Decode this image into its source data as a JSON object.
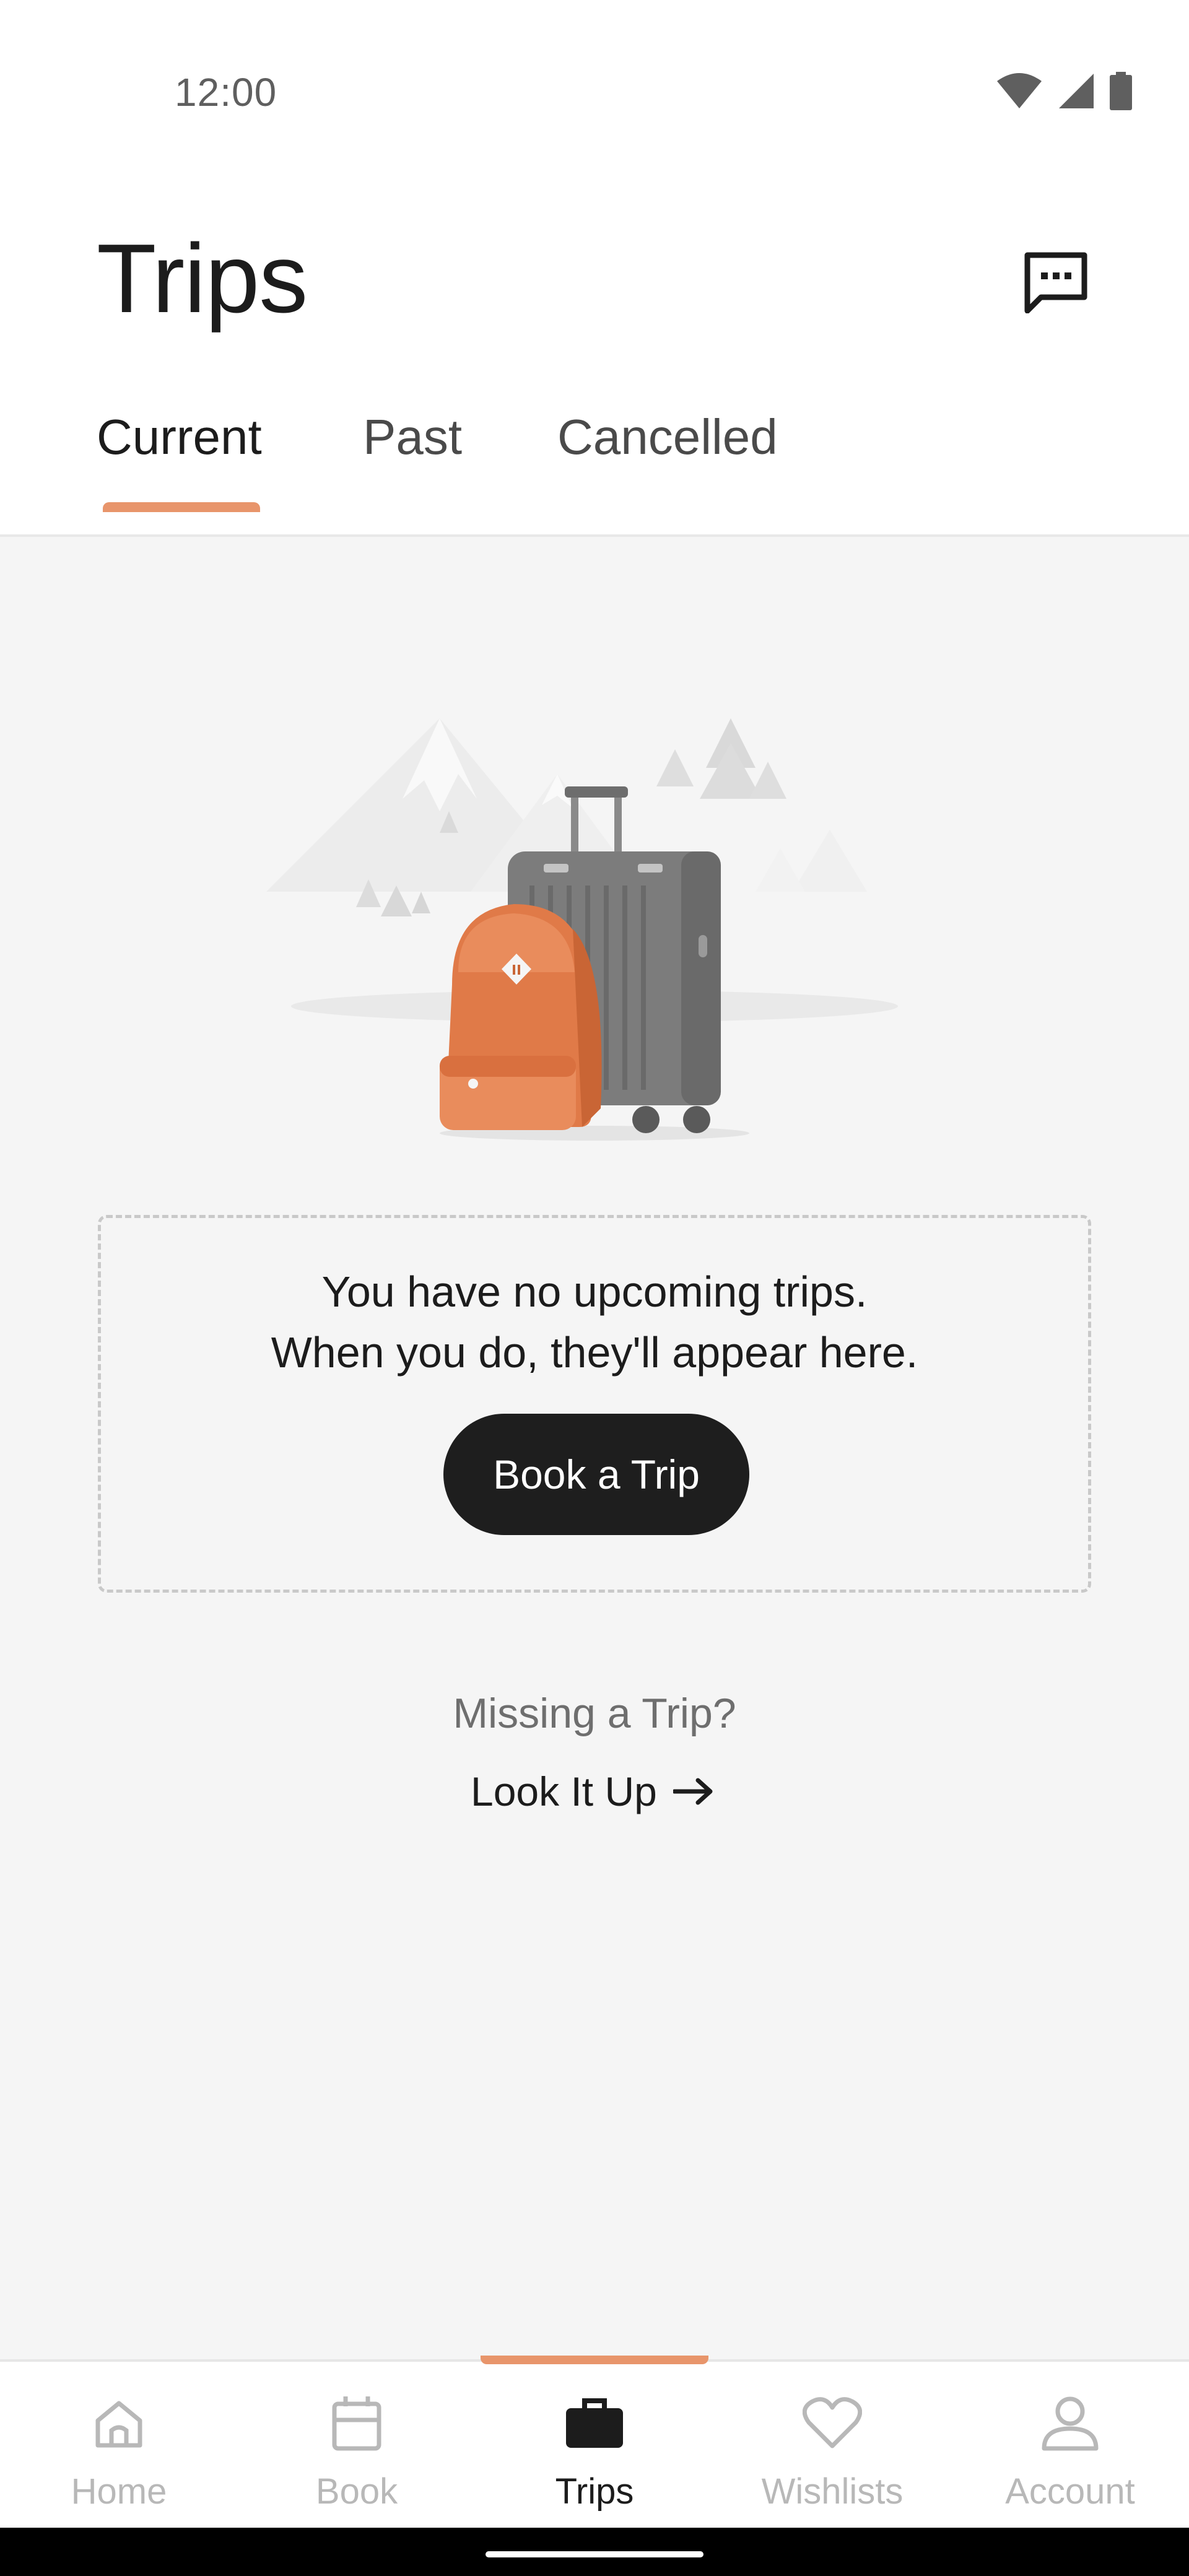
{
  "status_bar": {
    "time": "12:00"
  },
  "header": {
    "title": "Trips",
    "tabs": [
      {
        "label": "Current",
        "active": true
      },
      {
        "label": "Past",
        "active": false
      },
      {
        "label": "Cancelled",
        "active": false
      }
    ]
  },
  "empty_state": {
    "line1": "You have no upcoming trips.",
    "line2": "When you do, they'll appear here.",
    "button_label": "Book a Trip"
  },
  "missing_trip": {
    "title": "Missing a Trip?",
    "link_label": "Look It Up"
  },
  "bottom_nav": {
    "items": [
      {
        "label": "Home",
        "icon": "home-icon",
        "active": false
      },
      {
        "label": "Book",
        "icon": "calendar-icon",
        "active": false
      },
      {
        "label": "Trips",
        "icon": "briefcase-icon",
        "active": true
      },
      {
        "label": "Wishlists",
        "icon": "heart-icon",
        "active": false
      },
      {
        "label": "Account",
        "icon": "person-icon",
        "active": false
      }
    ]
  },
  "colors": {
    "accent": "#e8956b",
    "primary_button": "#1e1e1e",
    "background": "#f5f5f5",
    "inactive_nav": "#b8b8b8"
  }
}
